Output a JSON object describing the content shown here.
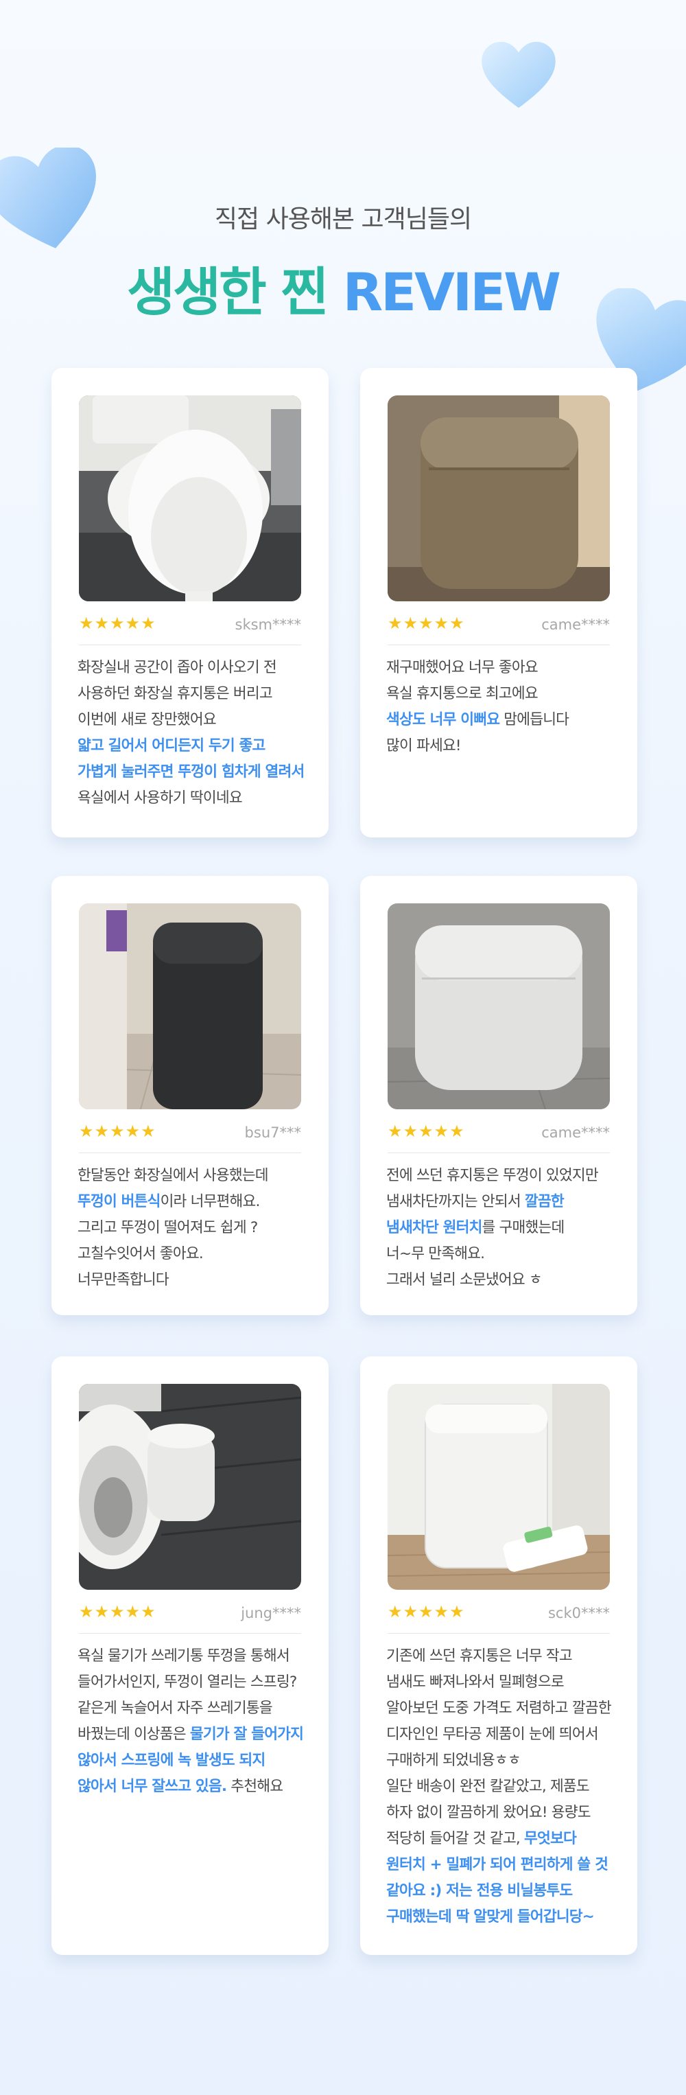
{
  "header": {
    "subtitle": "직접 사용해본 고객님들의",
    "title_kr": "생생한 찐",
    "title_en": "REVIEW"
  },
  "colors": {
    "accent_teal": "#2bb8a0",
    "accent_blue": "#4a9df0",
    "highlight": "#3d8ff0",
    "star": "#f7c21c"
  },
  "reviews": [
    {
      "rating": 5,
      "user": "sksm****",
      "photo": "white toilet with bidet seat",
      "lines": [
        {
          "text": "화장실내 공간이 좁아 이사오기 전",
          "hl": false
        },
        {
          "text": "사용하던 화장실 휴지통은 버리고",
          "hl": false
        },
        {
          "text": "이번에 새로 장만했어요",
          "hl": false
        },
        {
          "text": "얇고 길어서 어디든지 두기 좋고",
          "hl": true
        },
        {
          "text": "가볍게 눌러주면 뚜껑이 힘차게 열려서",
          "hl": true
        },
        {
          "text": "욕실에서 사용하기 딱이네요",
          "hl": false
        }
      ]
    },
    {
      "rating": 5,
      "user": "came****",
      "photo": "beige slim trash can",
      "lines": [
        {
          "text": "재구매했어요 너무 좋아요",
          "hl": false
        },
        {
          "text": "욕실 휴지통으로 최고에요",
          "hl": false
        },
        {
          "text": "색상도 너무 이뻐요",
          "hl": true,
          "rest": " 맘에듭니다"
        },
        {
          "text": "많이 파세요!",
          "hl": false
        }
      ]
    },
    {
      "rating": 5,
      "user": "bsu7***",
      "photo": "black trash can in bathroom",
      "lines": [
        {
          "text": "한달동안 화장실에서 사용했는데",
          "hl": false
        },
        {
          "text": "뚜껑이 버튼식",
          "hl": true,
          "rest": "이라 너무편해요."
        },
        {
          "text": "그리고 뚜껑이 떨어져도 쉽게 ?",
          "hl": false
        },
        {
          "text": "고칠수잇어서 좋아요.",
          "hl": false
        },
        {
          "text": "너무만족합니다",
          "hl": false
        }
      ]
    },
    {
      "rating": 5,
      "user": "came****",
      "photo": "white trash can on tile floor",
      "lines": [
        {
          "text": "전에 쓰던 휴지통은 뚜껑이 있었지만",
          "hl": false
        },
        {
          "text": "냄새차단까지는 안되서 ",
          "hl": false,
          "rest_hl": "깔끔한"
        },
        {
          "text": "냄새차단 원터치",
          "hl": true,
          "rest": "를 구매했는데"
        },
        {
          "text": "너~무 만족해요.",
          "hl": false
        },
        {
          "text": "그래서 널리 소문냈어요 ㅎ",
          "hl": false
        }
      ]
    },
    {
      "rating": 5,
      "user": "jung****",
      "photo": "toilet and white trash can on dark tile",
      "lines": [
        {
          "text": "욕실 물기가 쓰레기통 뚜껑을 통해서",
          "hl": false
        },
        {
          "text": "들어가서인지, 뚜껑이 열리는 스프링?",
          "hl": false
        },
        {
          "text": "같은게 녹슬어서 자주 쓰레기통을",
          "hl": false
        },
        {
          "text": "바꿨는데 이상품은 ",
          "hl": false,
          "rest_hl": "물기가 잘 들어가지"
        },
        {
          "text": "않아서 스프링에 녹 발생도 되지",
          "hl": true
        },
        {
          "text": "않아서 너무 잘쓰고 있음.",
          "hl": true,
          "rest": " 추천해요"
        }
      ]
    },
    {
      "rating": 5,
      "user": "sck0****",
      "photo": "white trash can with liner bags",
      "lines": [
        {
          "text": "기존에 쓰던 휴지통은 너무 작고",
          "hl": false
        },
        {
          "text": "냄새도 빠져나와서 밀폐형으로",
          "hl": false
        },
        {
          "text": "알아보던 도중 가격도 저렴하고 깔끔한",
          "hl": false
        },
        {
          "text": "디자인인 무타공 제품이 눈에 띄어서",
          "hl": false
        },
        {
          "text": "구매하게 되었네용ㅎㅎ",
          "hl": false
        },
        {
          "text": "일단 배송이 완전 칼같았고, 제품도",
          "hl": false
        },
        {
          "text": "하자 없이 깔끔하게 왔어요! 용량도",
          "hl": false
        },
        {
          "text": "적당히 들어갈 것 같고, ",
          "hl": false,
          "rest_hl": "무엇보다"
        },
        {
          "text": "원터치 + 밀폐가 되어 편리하게 쓸 것",
          "hl": true
        },
        {
          "text": "같아요 :) 저는 전용 비닐봉투도",
          "hl": true
        },
        {
          "text": "구매했는데 딱 알맞게 들어갑니당~",
          "hl": true
        }
      ]
    }
  ]
}
